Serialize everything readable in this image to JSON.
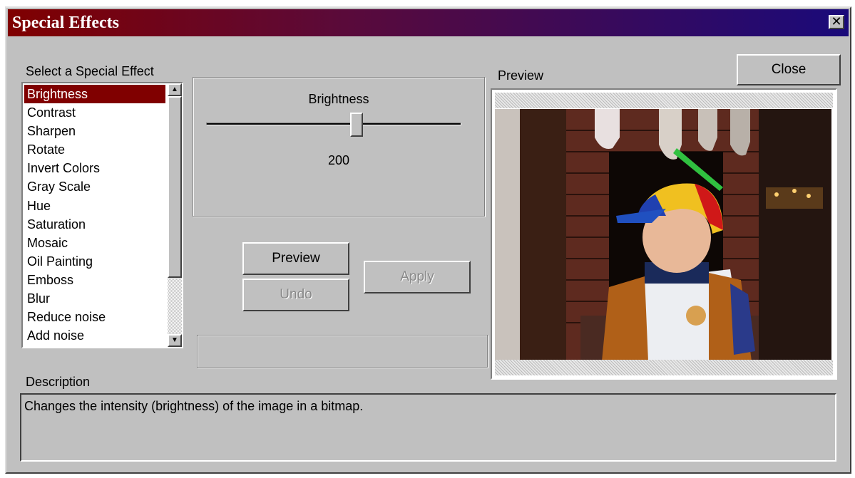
{
  "window": {
    "title": "Special Effects",
    "close_glyph": "✕"
  },
  "labels": {
    "select_effect": "Select a Special Effect",
    "preview": "Preview",
    "description": "Description"
  },
  "effects": [
    "Brightness",
    "Contrast",
    "Sharpen",
    "Rotate",
    "Invert Colors",
    "Gray Scale",
    "Hue",
    "Saturation",
    "Mosaic",
    "Oil Painting",
    "Emboss",
    "Blur",
    "Reduce noise",
    "Add noise"
  ],
  "selected_effect_index": 0,
  "slider": {
    "label": "Brightness",
    "value": "200"
  },
  "buttons": {
    "close": "Close",
    "preview": "Preview",
    "undo": "Undo",
    "apply": "Apply"
  },
  "description_text": "Changes the intensity (brightness) of the image in a bitmap.",
  "colors": {
    "title_start": "#800000",
    "title_end": "#1a0a7a",
    "selection": "#800000",
    "face": "#c0c0c0"
  },
  "icons": {
    "scroll_up": "▲",
    "scroll_down": "▼"
  }
}
